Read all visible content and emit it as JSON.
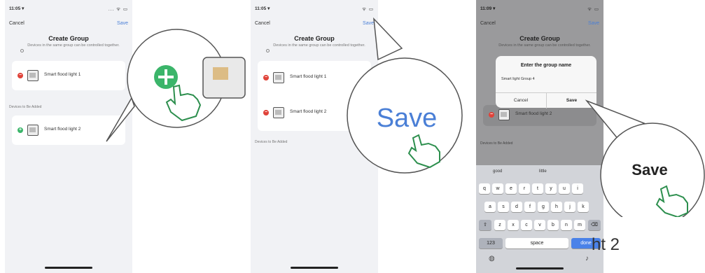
{
  "screen1": {
    "status_time": "11:05 ▾",
    "status_icons": "... ᯤ ▭",
    "cancel": "Cancel",
    "save": "Save",
    "title": "Create Group",
    "subtitle": "Devices in the same group can be controlled together.",
    "devices_in_group": [
      "Smart flood light 1"
    ],
    "section_label": "Devices to Be Added",
    "devices_to_add": [
      "Smart flood light 2"
    ]
  },
  "screen2": {
    "status_time": "11:05 ▾",
    "status_icons": "ᯤ ▭",
    "cancel": "Cancel",
    "save": "Save",
    "title": "Create Group",
    "subtitle": "Devices in the same group can be controlled together.",
    "devices_in_group": [
      "Smart flood light 1",
      "Smart flood light 2"
    ],
    "section_label": "Devices to Be Added",
    "zoom_label": "Save"
  },
  "screen3": {
    "status_time": "11:09 ▾",
    "status_icons": "ᯤ ▭",
    "cancel": "Cancel",
    "save": "Save",
    "title": "Create Group",
    "subtitle": "Devices in the same group can be controlled together.",
    "dialog_title": "Enter the group name",
    "dialog_value": "Smart light Group 4",
    "dialog_cancel": "Cancel",
    "dialog_save": "Save",
    "device_label": "Smart flood light 2",
    "section_label": "Devices to Be Added",
    "suggestions": [
      "good",
      "little"
    ],
    "keyboard_rows": [
      [
        "q",
        "w",
        "e",
        "r",
        "t",
        "y",
        "u",
        "i"
      ],
      [
        "a",
        "s",
        "d",
        "f",
        "g",
        "h",
        "j",
        "k"
      ],
      [
        "z",
        "x",
        "c",
        "v",
        "b",
        "n",
        "m"
      ]
    ],
    "key_123": "123",
    "key_space": "space",
    "key_done": "done",
    "zoom_label": "Save",
    "overflow_text": "ht 2"
  },
  "colors": {
    "accent": "#4a7fd6",
    "minus": "#e0433a",
    "plus": "#3bb56a"
  }
}
